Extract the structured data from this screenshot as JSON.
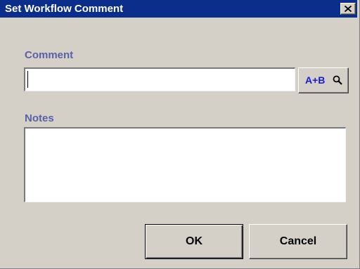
{
  "window": {
    "title": "Set Workflow Comment",
    "close_icon": "close-icon"
  },
  "comment": {
    "label": "Comment",
    "value": "",
    "lookup_button_label": "A+B",
    "lookup_icon": "magnifier-icon"
  },
  "notes": {
    "label": "Notes",
    "value": ""
  },
  "buttons": {
    "ok_label": "OK",
    "cancel_label": "Cancel"
  },
  "colors": {
    "titlebar": "#0b2e8a",
    "title_text": "#ffffff",
    "field_label": "#5a5fa6",
    "lookup_text": "#1a1ad6",
    "dialog_background": "#d4d0c8"
  }
}
